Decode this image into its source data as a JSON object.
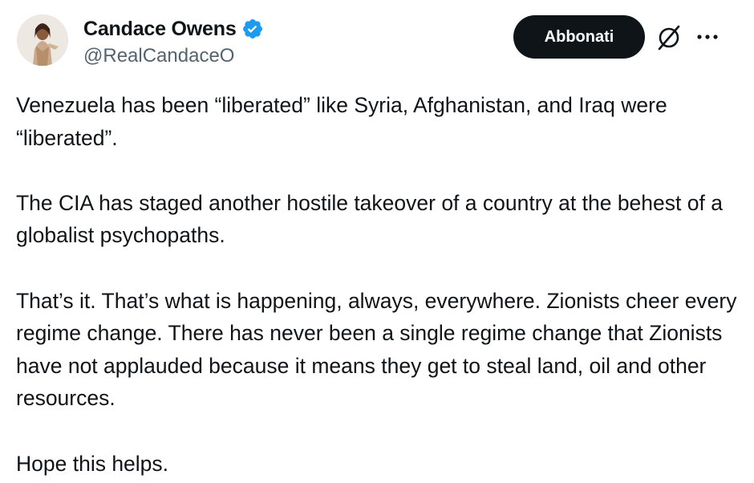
{
  "author": {
    "display_name": "Candace Owens",
    "handle": "@RealCandaceO",
    "verified": true,
    "verified_color": "#1d9bf0"
  },
  "actions": {
    "subscribe_label": "Abbonati",
    "grok_icon": "grok-slash-circle-icon",
    "more_icon": "more-horizontal-icon"
  },
  "tweet": {
    "paragraphs": [
      "Venezuela has been “liberated” like Syria, Afghanistan, and Iraq were “liberated”.",
      "The CIA has staged another hostile takeover of a country at the behest of a globalist psychopaths.",
      "That’s it. That’s what is happening, always, everywhere. Zionists cheer every regime change. There has never been a single regime change that Zionists have not applauded because it means they get to steal land, oil and other resources.",
      "Hope this helps."
    ]
  },
  "colors": {
    "text": "#0f1419",
    "secondary_text": "#536471",
    "button_bg": "#0f1419",
    "button_text": "#ffffff"
  }
}
